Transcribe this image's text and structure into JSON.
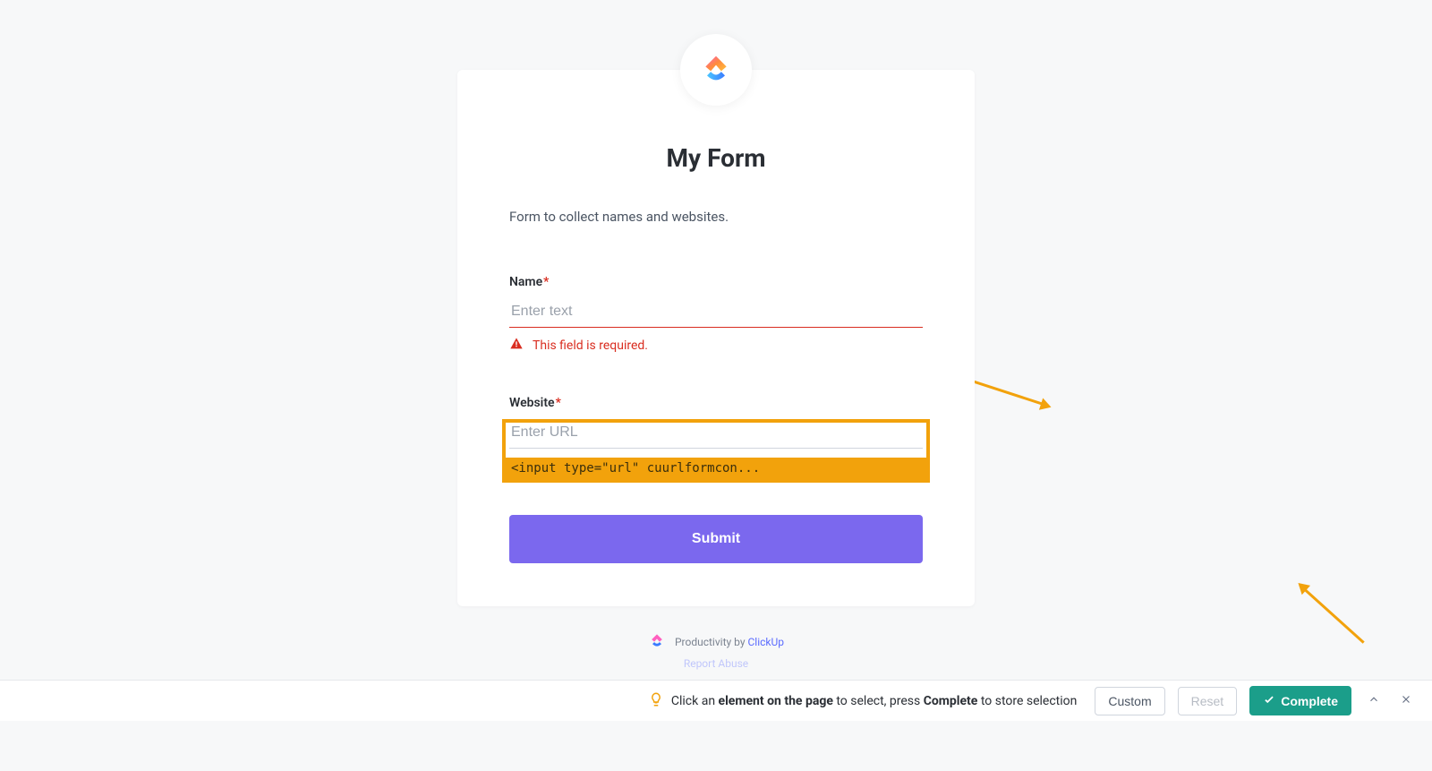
{
  "form": {
    "title": "My Form",
    "description": "Form to collect names and websites.",
    "fields": {
      "name": {
        "label": "Name",
        "required": "*",
        "placeholder": "Enter text",
        "error": "This field is required."
      },
      "website": {
        "label": "Website",
        "required": "*",
        "placeholder": "Enter URL"
      }
    },
    "submit": "Submit"
  },
  "selection": {
    "tag": "<input type=\"url\" cuurlformcon..."
  },
  "footer": {
    "prefix": "Productivity by ",
    "brand": "ClickUp",
    "abuse": "Report Abuse"
  },
  "toolbar": {
    "hint_pre": "Click an ",
    "hint_bold1": "element on the page",
    "hint_mid": " to select, press ",
    "hint_bold2": "Complete",
    "hint_post": " to store selection",
    "custom": "Custom",
    "reset": "Reset",
    "complete": "Complete"
  }
}
